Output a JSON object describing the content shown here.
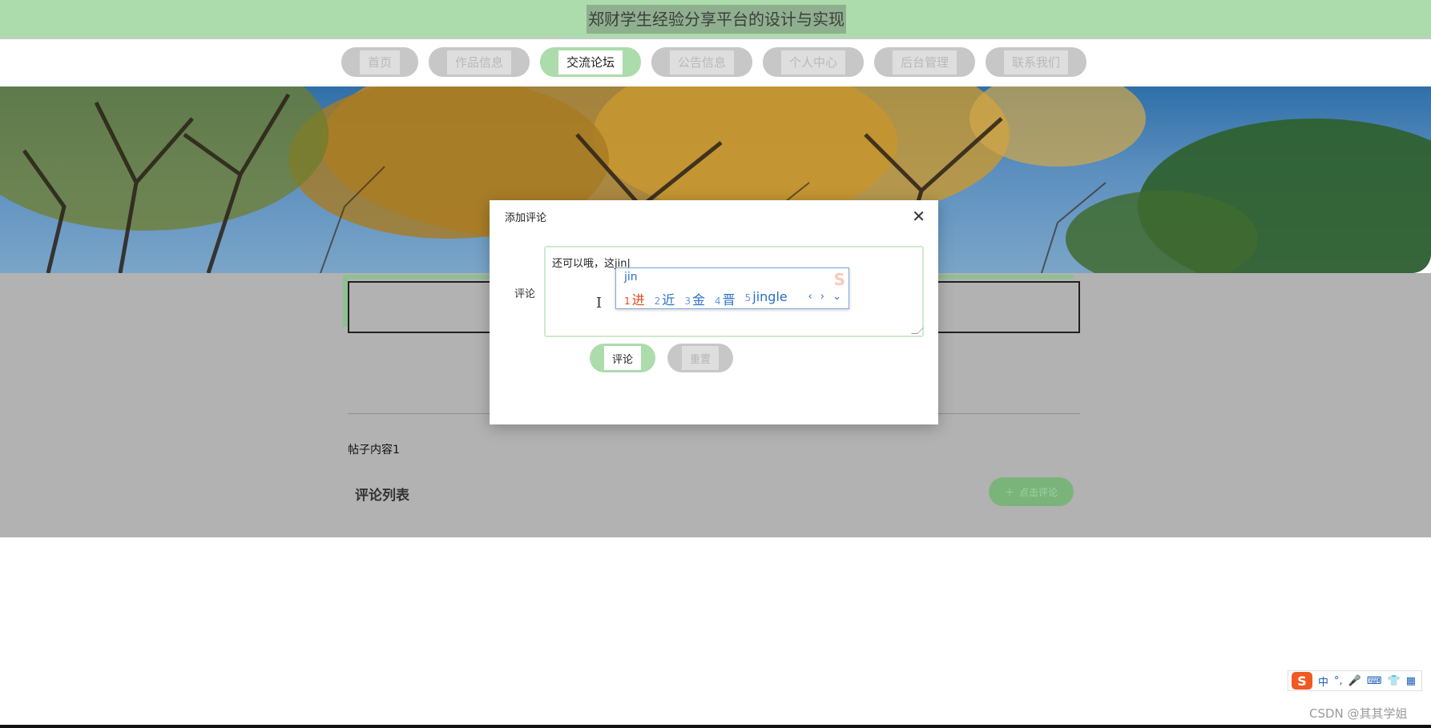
{
  "header": {
    "title": "郑财学生经验分享平台的设计与实现"
  },
  "nav": {
    "items": [
      {
        "label": "首页",
        "width": 96
      },
      {
        "label": "作品信息",
        "width": 126
      },
      {
        "label": "交流论坛",
        "width": 126,
        "active": true
      },
      {
        "label": "公告信息",
        "width": 126
      },
      {
        "label": "个人中心",
        "width": 126
      },
      {
        "label": "后台管理",
        "width": 126
      },
      {
        "label": "联系我们",
        "width": 126
      }
    ]
  },
  "post": {
    "content": "帖子内容1",
    "comments_title": "评论列表",
    "comment_button": "点击评论"
  },
  "modal": {
    "title": "添加评论",
    "field_label": "评论",
    "textarea_value": "还可以哦，这jin",
    "submit_label": "评论",
    "reset_label": "重置"
  },
  "ime": {
    "input": "jin",
    "candidates": [
      {
        "num": "1",
        "text": "进"
      },
      {
        "num": "2",
        "text": "近"
      },
      {
        "num": "3",
        "text": "金"
      },
      {
        "num": "4",
        "text": "晋"
      },
      {
        "num": "5",
        "text": "jingle"
      }
    ],
    "arrows": "‹ › ⌄"
  },
  "toolbar": {
    "logo": "S",
    "items": [
      "中",
      "°,",
      "🎤",
      "⌨",
      "👕",
      "▦"
    ]
  },
  "watermark": "CSDN @其其学姐",
  "colors": {
    "accent": "#acdcac",
    "overlay": "#b2b2b2"
  }
}
